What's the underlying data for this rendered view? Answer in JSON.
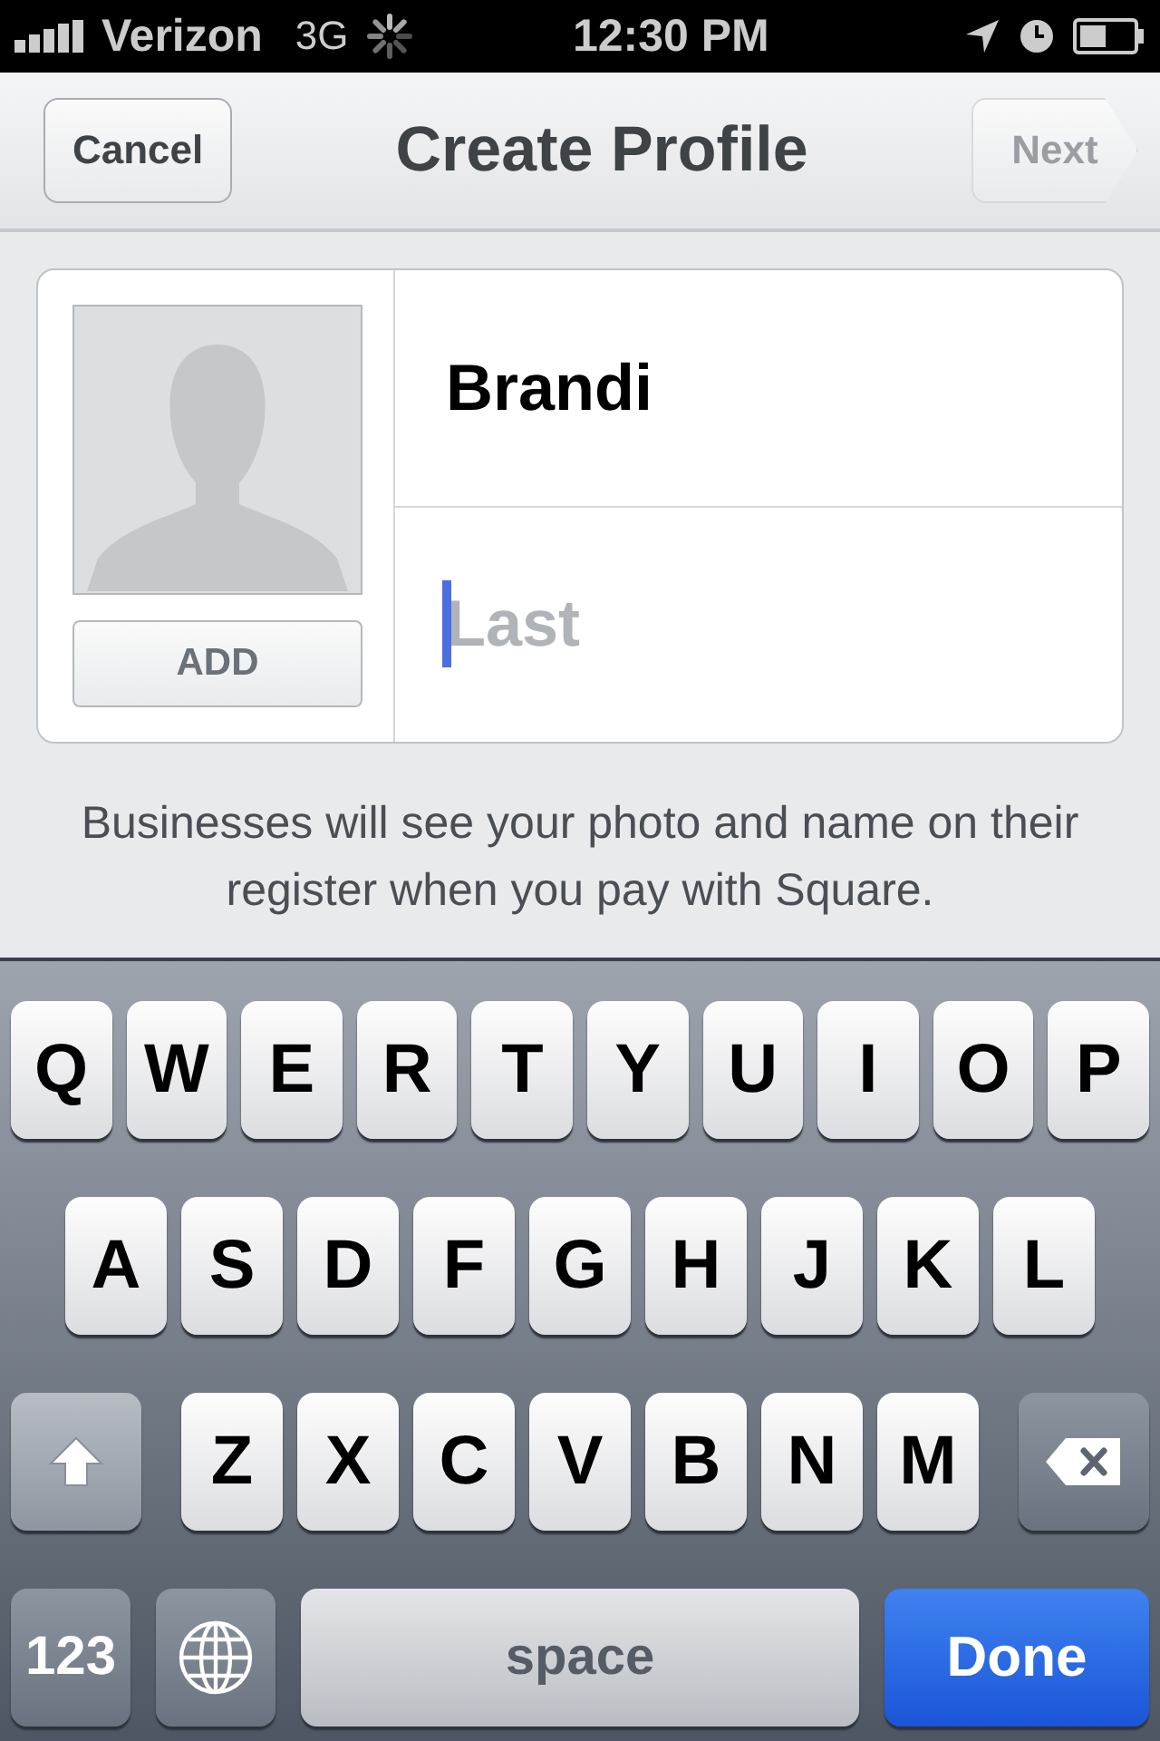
{
  "status_bar": {
    "carrier": "Verizon",
    "network": "3G",
    "time": "12:30 PM"
  },
  "nav": {
    "title": "Create Profile",
    "left_button": "Cancel",
    "right_button": {
      "label": "Next",
      "disabled": true
    }
  },
  "profile": {
    "add_button": "ADD",
    "first_name": {
      "value": "Brandi",
      "focused": false
    },
    "last_name": {
      "placeholder": "Last",
      "focused": true
    }
  },
  "caption": "Businesses will see your photo and name on their register when you pay with Square.",
  "keyboard": {
    "rows": [
      [
        "Q",
        "W",
        "E",
        "R",
        "T",
        "Y",
        "U",
        "I",
        "O",
        "P"
      ],
      [
        "A",
        "S",
        "D",
        "F",
        "G",
        "H",
        "J",
        "K",
        "L"
      ],
      [
        "Z",
        "X",
        "C",
        "V",
        "B",
        "N",
        "M"
      ]
    ],
    "numbers": "123",
    "space": "space",
    "done": "Done"
  }
}
